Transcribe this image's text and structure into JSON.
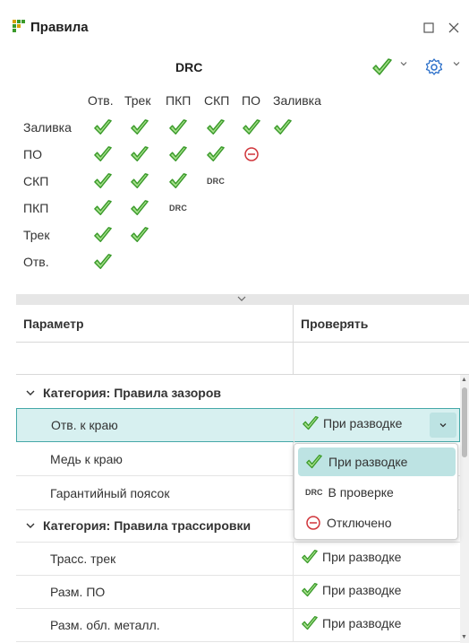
{
  "window": {
    "title": "Правила",
    "maximize_icon": "maximize-icon",
    "close_icon": "close-icon"
  },
  "drc": {
    "title": "DRC",
    "columns": [
      "Отв.",
      "Трек",
      "ПКП",
      "СКП",
      "ПО",
      "Заливка"
    ],
    "rows": [
      {
        "label": "Заливка",
        "cells": [
          "check",
          "check",
          "check",
          "check",
          "check",
          "check"
        ]
      },
      {
        "label": "ПО",
        "cells": [
          "check",
          "check",
          "check",
          "check",
          "off"
        ]
      },
      {
        "label": "СКП",
        "cells": [
          "check",
          "check",
          "check",
          "DRC"
        ]
      },
      {
        "label": "ПКП",
        "cells": [
          "check",
          "check",
          "DRC"
        ]
      },
      {
        "label": "Трек",
        "cells": [
          "check",
          "check"
        ]
      },
      {
        "label": "Отв.",
        "cells": [
          "check"
        ]
      }
    ]
  },
  "grid": {
    "col_parameter": "Параметр",
    "col_check": "Проверять",
    "rows": [
      {
        "type": "category",
        "label": "Категория: Правила зазоров"
      },
      {
        "type": "item",
        "name": "Отв. к краю",
        "value": "При разводке",
        "selected": true
      },
      {
        "type": "item",
        "name": "Медь к краю",
        "value": ""
      },
      {
        "type": "item",
        "name": "Гарантийный поясок",
        "value": ""
      },
      {
        "type": "category",
        "label": "Категория: Правила трассировки"
      },
      {
        "type": "item",
        "name": "Трасс. трек",
        "value": "При разводке"
      },
      {
        "type": "item",
        "name": "Разм. ПО",
        "value": "При разводке"
      },
      {
        "type": "item",
        "name": "Разм. обл. металл.",
        "value": "При разводке"
      }
    ]
  },
  "dropdown": {
    "options": [
      {
        "icon": "check",
        "label": "При разводке",
        "active": true
      },
      {
        "icon": "DRC",
        "label": "В проверке",
        "active": false
      },
      {
        "icon": "off",
        "label": "Отключено",
        "active": false
      }
    ]
  },
  "colors": {
    "check_green": "#3a9a2a",
    "check_fill": "#a5e08a",
    "off_red": "#d0343a",
    "selection_bg": "#d7f0f0",
    "selection_border": "#45a8a8",
    "gear_blue": "#2b6fc9"
  }
}
